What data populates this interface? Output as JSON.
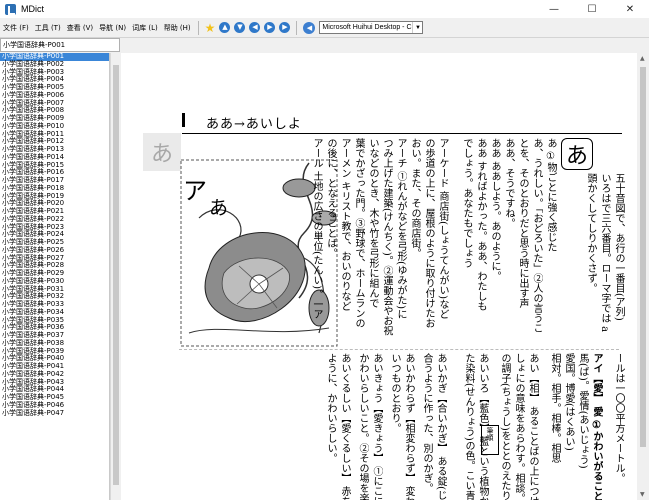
{
  "window": {
    "title": "MDict",
    "minimize": "—",
    "maximize": "☐",
    "close": "✕"
  },
  "menu": [
    "文件 (F)",
    "工具 (T)",
    "查看 (V)",
    "导航 (N)",
    "词库 (L)",
    "帮助 (H)"
  ],
  "toolbar": {
    "favorite_icon": "star-icon",
    "nav_buttons": [
      "▲",
      "▼",
      "◀",
      "▶",
      "▶"
    ],
    "speaker_icon": "speaker-icon",
    "voice": "Microsoft Huihui Desktop - C"
  },
  "search": {
    "value": "小学国语辞典-P001"
  },
  "wordlist": {
    "selected_index": 0,
    "items": [
      "小学国语辞典-P001",
      "小学国语辞典-P002",
      "小学国语辞典-P003",
      "小学国语辞典-P004",
      "小学国语辞典-P005",
      "小学国语辞典-P006",
      "小学国语辞典-P007",
      "小学国语辞典-P008",
      "小学国语辞典-P009",
      "小学国语辞典-P010",
      "小学国语辞典-P011",
      "小学国语辞典-P012",
      "小学国语辞典-P013",
      "小学国语辞典-P014",
      "小学国语辞典-P015",
      "小学国语辞典-P016",
      "小学国语辞典-P017",
      "小学国语辞典-P018",
      "小学国语辞典-P019",
      "小学国语辞典-P020",
      "小学国语辞典-P021",
      "小学国语辞典-P022",
      "小学国语辞典-P023",
      "小学国语辞典-P024",
      "小学国语辞典-P025",
      "小学国语辞典-P026",
      "小学国语辞典-P027",
      "小学国语辞典-P028",
      "小学国语辞典-P029",
      "小学国语辞典-P030",
      "小学国语辞典-P031",
      "小学国语辞典-P032",
      "小学国语辞典-P033",
      "小学国语辞典-P034",
      "小学国语辞典-P035",
      "小学国语辞典-P036",
      "小学国语辞典-P037",
      "小学国语辞典-P038",
      "小学国语辞典-P039",
      "小学国语辞典-P040",
      "小学国语辞典-P041",
      "小学国语辞典-P042",
      "小学国语辞典-P043",
      "小学国语辞典-P044",
      "小学国语辞典-P045",
      "小学国语辞典-P046",
      "小学国语辞典-P047"
    ]
  },
  "page": {
    "header": "ああ→あいしよ",
    "grey_kana": "あ",
    "kana_box": "あ",
    "illus_a1": "ア",
    "illus_a2": "あ",
    "col_r1": "五十音図で、あ行の一番目(ア列)",
    "col_r2": "いろはで三六番目。ローマ字では a",
    "col_r3": "頭かくしてしりかくさず。",
    "col_r4": "あ ①物ごとに強く感じた",
    "col_r5": "あ、うれしい。「おどろいた」②人の言うこ",
    "col_r6": "とを、そのとおりだと思う時に出す声",
    "col_r7": "ああ、そうですね。",
    "col_r8": "ああ ああしよう。あのように。",
    "col_r9": "ああ すればよかった。ああ、わたしも",
    "col_r10": "でしょう。あなたもでしょう",
    "col_m1": "アーケード 商店街(しょうてんがい)など",
    "col_m2": "の歩道の上に、屋根のように取り付けたお",
    "col_m3": "おい。また、その商店街。",
    "col_m4": "アーチ ①れんがなどを弓形(ゆみがた)に",
    "col_m5": "つみ上げた建築(けんちく)。②運動会やお祝",
    "col_m6": "いなどのとき、木や竹を弓形に組んで",
    "col_m7": "葉でかざった門。③野球で、ホームランの",
    "col_m8": "アーメン キリスト教で、おいのりなど",
    "col_m9": "の後に、となえることば。",
    "col_m10": "アール 土地の広さの単位(たんい)。一ア",
    "bot_r1": "ールは一〇〇平方メートル。",
    "bot_r2": "アイ【愛】 愛 ①かわいがること。恋愛",
    "bot_r3": "馬(ば)。愛情(あいじょう)",
    "bot_r4": "愛国。博愛(はくあい)",
    "bot_r5": "相対。相手。相棒。相思",
    "bot_m1": "あい【相】 あることばの上につけて、いっ",
    "bot_m2": "しょにの意味をあらわす。相談。",
    "bot_m3": "の調子(ちょうし)をととのえたりする",
    "bot_m4": "あいいろ【藍色】 藍という植物からとっ",
    "bot_m5": "た染料(せんりょう)の色。こい青色。",
    "bot_l1": "あいかぎ【合いかぎ】 ある錠(じょう)に",
    "bot_l2": "合うように作った、別のかぎ。",
    "bot_l3": "あいかわらず【相変わらず】 変わらずに、",
    "bot_l4": "いつものとおり。",
    "bot_l5": "あいきょう【愛きょう】 ①にこにこして、",
    "bot_l6": "かわいらしいこと。②その場を楽しくする",
    "bot_l7": "あいくるしい【愛くるしい】 赤ちゃんの",
    "bot_l8": "ように、かわいらしい。",
    "tag_label": "筆順"
  }
}
